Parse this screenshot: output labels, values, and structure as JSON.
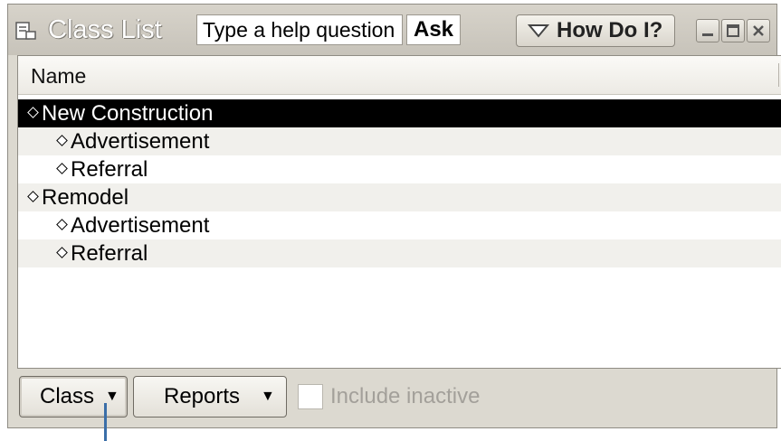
{
  "window": {
    "title": "Class List",
    "help_placeholder": "Type a help question",
    "ask_label": "Ask",
    "howdo_label": "How Do I?"
  },
  "list": {
    "column_header": "Name",
    "rows": [
      {
        "label": "New Construction",
        "level": 0,
        "selected": true
      },
      {
        "label": "Advertisement",
        "level": 1
      },
      {
        "label": "Referral",
        "level": 1
      },
      {
        "label": "Remodel",
        "level": 0
      },
      {
        "label": "Advertisement",
        "level": 1
      },
      {
        "label": "Referral",
        "level": 1
      }
    ]
  },
  "bottom": {
    "class_button": "Class",
    "reports_button": "Reports",
    "include_inactive": "Include inactive"
  },
  "colors": {
    "selection": "#000000",
    "window_bg": "#dcd9d0",
    "pointer": "#3a6ea8"
  },
  "icons": [
    "class-list-icon",
    "triangle-down-icon",
    "minimize-icon",
    "maximize-icon",
    "close-icon",
    "dropdown-arrow-icon"
  ]
}
